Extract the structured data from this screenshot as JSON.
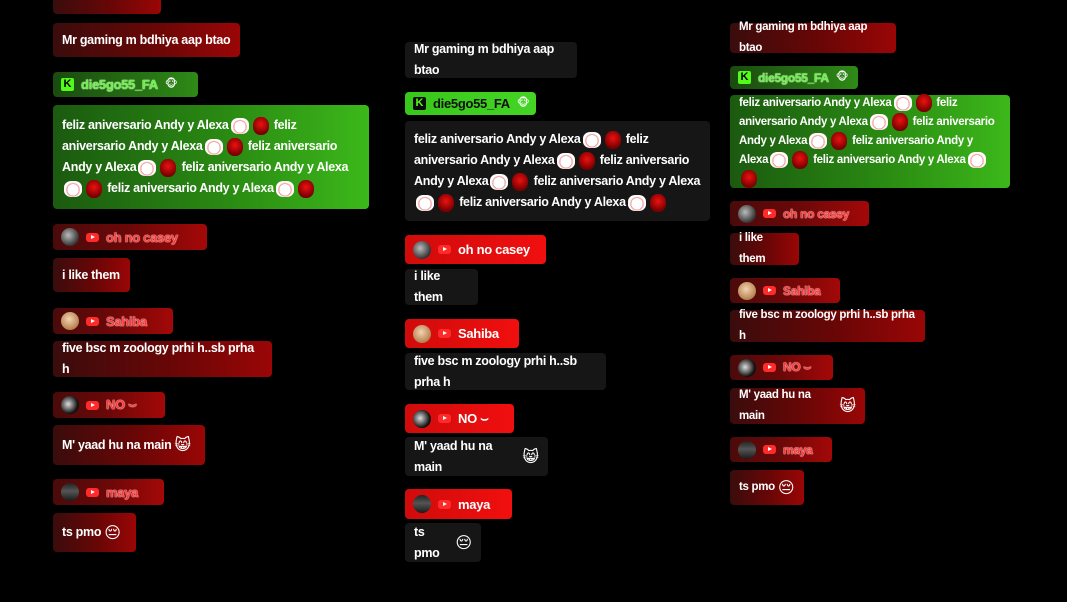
{
  "emote_labels": {
    "cat": "cat-heart-emote",
    "blob": "red-blob-emote"
  },
  "chat": {
    "msg_mr_gaming": "Mr gaming m bdhiya aap btao",
    "user_kick": "die5go55_FA",
    "kick_face": "🐵",
    "feliz": "feliz aniversario Andy y Alexa",
    "user_casey": "oh no casey",
    "msg_like": "i like them",
    "user_sahiba": "Sahiba",
    "msg_bsc": "five bsc m zoology prhi h..sb prha h",
    "user_no": "NO ⌣",
    "msg_yaad": "M' yaad hu na main",
    "emoji_cat": "😸",
    "user_maya": "maya",
    "msg_pmo": "ts pmo",
    "emoji_pensive": "😔"
  },
  "colors": {
    "red": "#9a0606",
    "green": "#3cb81a",
    "dark": "#161616",
    "bright_red": "#f10f0f"
  }
}
